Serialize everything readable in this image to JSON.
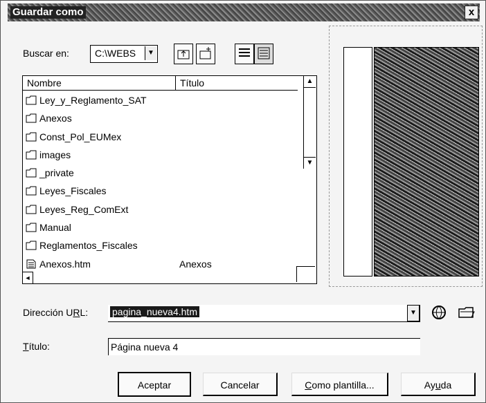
{
  "window": {
    "title": "Guardar como",
    "close_glyph": "x"
  },
  "toolbar": {
    "lookin_label": "Buscar en:",
    "lookin_value": "C:\\WEBS",
    "icons": [
      "up-folder-icon",
      "new-folder-icon",
      "list-view-icon",
      "details-view-icon"
    ]
  },
  "file_list": {
    "columns": [
      "Nombre",
      "Título"
    ],
    "items": [
      {
        "name": "Ley_y_Reglamento_SAT",
        "title": "",
        "icon": "folder"
      },
      {
        "name": "Anexos",
        "title": "",
        "icon": "folder"
      },
      {
        "name": "Const_Pol_EUMex",
        "title": "",
        "icon": "folder"
      },
      {
        "name": "images",
        "title": "",
        "icon": "folder"
      },
      {
        "name": "_private",
        "title": "",
        "icon": "folder"
      },
      {
        "name": "Leyes_Fiscales",
        "title": "",
        "icon": "folder"
      },
      {
        "name": "Leyes_Reg_ComExt",
        "title": "",
        "icon": "folder"
      },
      {
        "name": "Manual",
        "title": "",
        "icon": "folder"
      },
      {
        "name": "Reglamentos_Fiscales",
        "title": "",
        "icon": "folder"
      },
      {
        "name": "Anexos.htm",
        "title": "Anexos",
        "icon": "file"
      }
    ]
  },
  "form": {
    "url_label_prefix": "Dirección U",
    "url_label_accel": "R",
    "url_label_suffix": "L:",
    "url_value": "pagina_nueva4.htm",
    "title_label_accel": "T",
    "title_label_suffix": "ítulo:",
    "title_value": "Página nueva 4"
  },
  "buttons": {
    "accept": "Aceptar",
    "cancel": "Cancelar",
    "template_accel": "C",
    "template_rest": "omo plantilla...",
    "help_prefix": "Ay",
    "help_accel": "u",
    "help_suffix": "da"
  }
}
